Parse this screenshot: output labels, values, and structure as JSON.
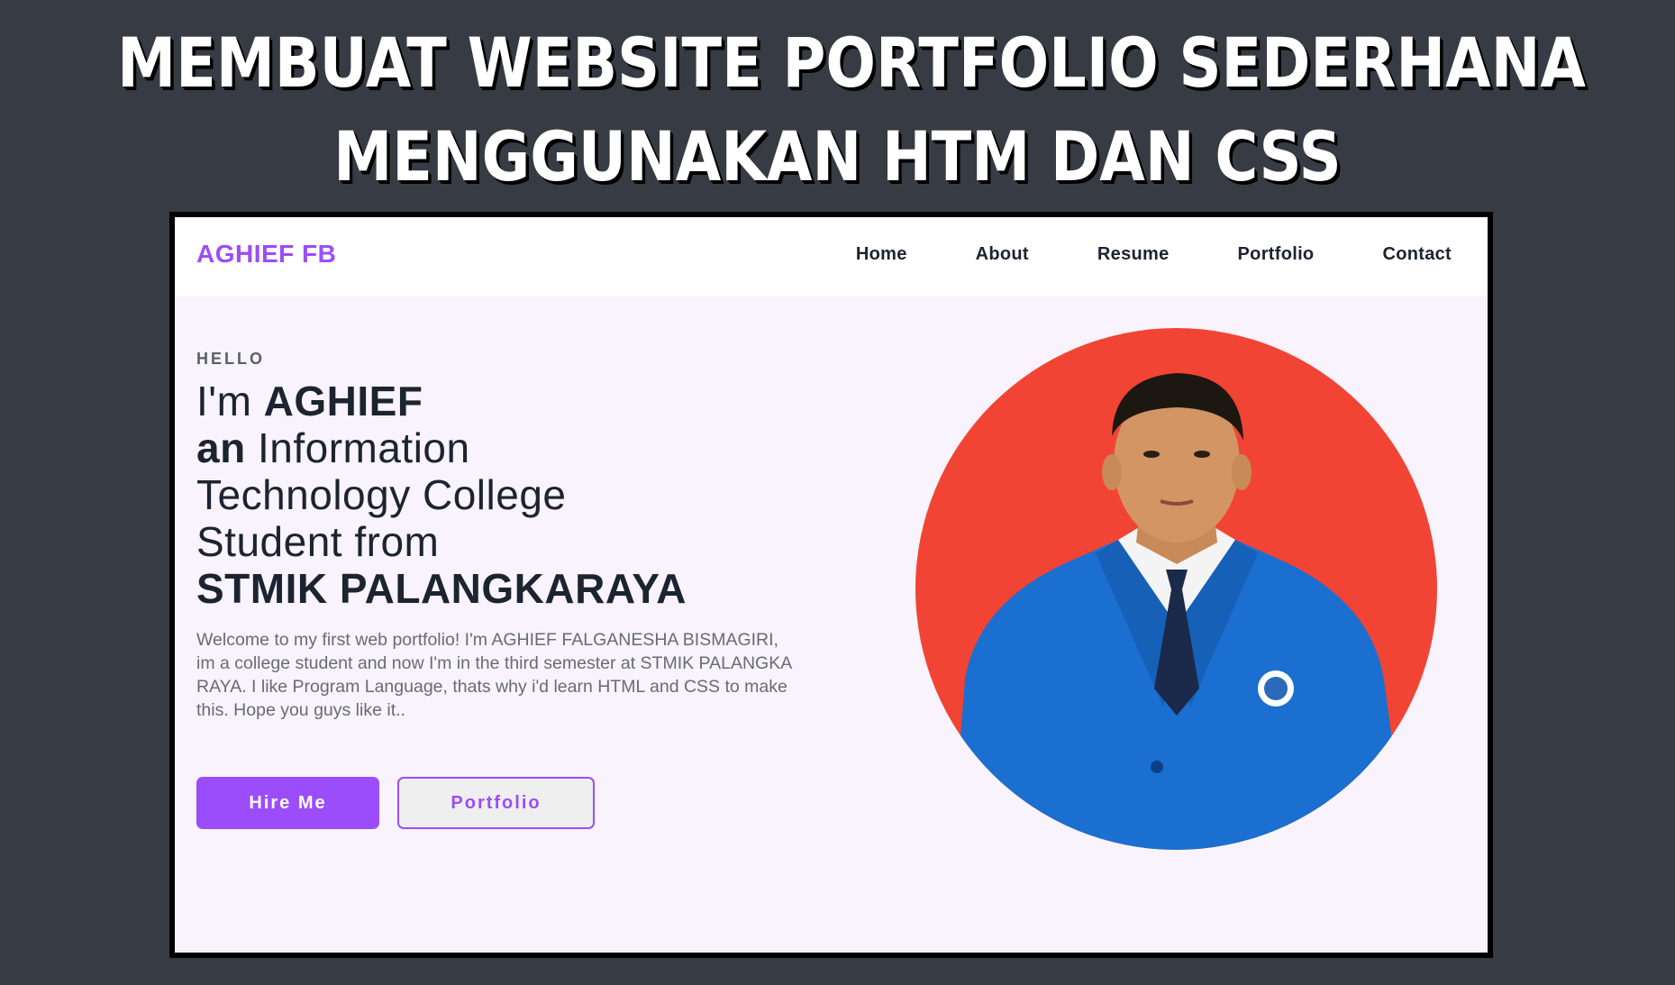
{
  "headline": {
    "line1": "MEMBUAT WEBSITE PORTFOLIO SEDERHANA",
    "line2": "MENGGUNAKAN HTM DAN CSS"
  },
  "site": {
    "brand": "AGHIEF FB",
    "nav": [
      "Home",
      "About",
      "Resume",
      "Portfolio",
      "Contact"
    ],
    "hero": {
      "eyebrow": "HELLO",
      "im": "I'm",
      "name": "AGHIEF",
      "an": "an",
      "line2_rest": "Information",
      "line3": "Technology College",
      "line4": "Student from",
      "school": "STMIK PALANGKARAYA",
      "intro": "Welcome to my first web portfolio! I'm AGHIEF FALGANESHA BISMAGIRI, im a college student and now I'm in the third semester at STMIK PALANGKA RAYA. I like Program Language, thats why i'd learn HTML and CSS to make this. Hope you guys like it..",
      "hire_label": "Hire Me",
      "portfolio_label": "Portfolio"
    }
  },
  "colors": {
    "page_bg": "#373b44",
    "accent": "#9b4dfa",
    "hero_bg": "#f8f3fc",
    "photo_bg": "#f24434",
    "jacket": "#1a6fd0"
  }
}
